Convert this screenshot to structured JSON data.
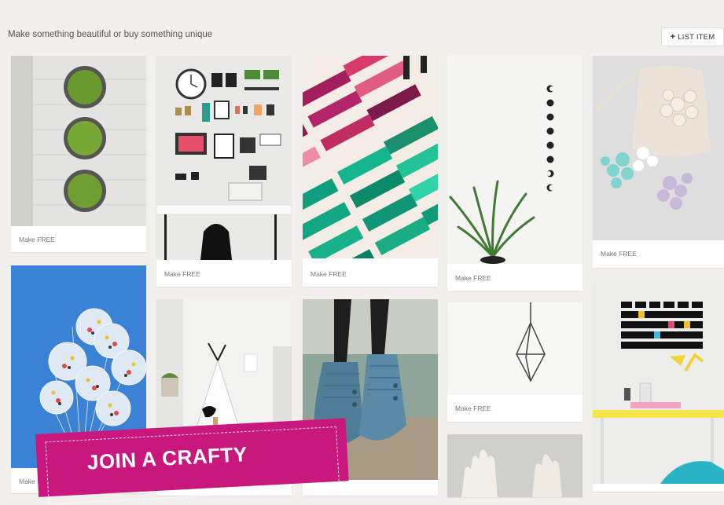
{
  "header": {
    "breadcrumb": "",
    "menu": ""
  },
  "tagline": "Make something beautiful or buy something unique",
  "list_button": {
    "icon": "plus-icon",
    "label": "LIST ITEM"
  },
  "cards": [
    {
      "subject": "wall-planters",
      "label": "Make FREE"
    },
    {
      "subject": "craft-desk",
      "label": "Make FREE"
    },
    {
      "subject": "dyed-tags",
      "label": "Make FREE"
    },
    {
      "subject": "moon-phase-plant",
      "label": "Make FREE"
    },
    {
      "subject": "crochet-pouch",
      "label": "Make FREE"
    },
    {
      "subject": "confetti-balloons",
      "label": "Make"
    },
    {
      "subject": "kids-teepee",
      "label": ""
    },
    {
      "subject": "knit-slipper-socks",
      "label": ""
    },
    {
      "subject": "himmeli-geometric",
      "label": "Make FREE"
    },
    {
      "subject": "calendar-desk",
      "label": ""
    },
    {
      "subject": "white-gloves",
      "label": ""
    }
  ],
  "banner": {
    "text": "JOIN A CRAFTY"
  },
  "colors": {
    "background": "#f1f0ec",
    "banner": "#c8187e",
    "card": "#ffffff"
  }
}
